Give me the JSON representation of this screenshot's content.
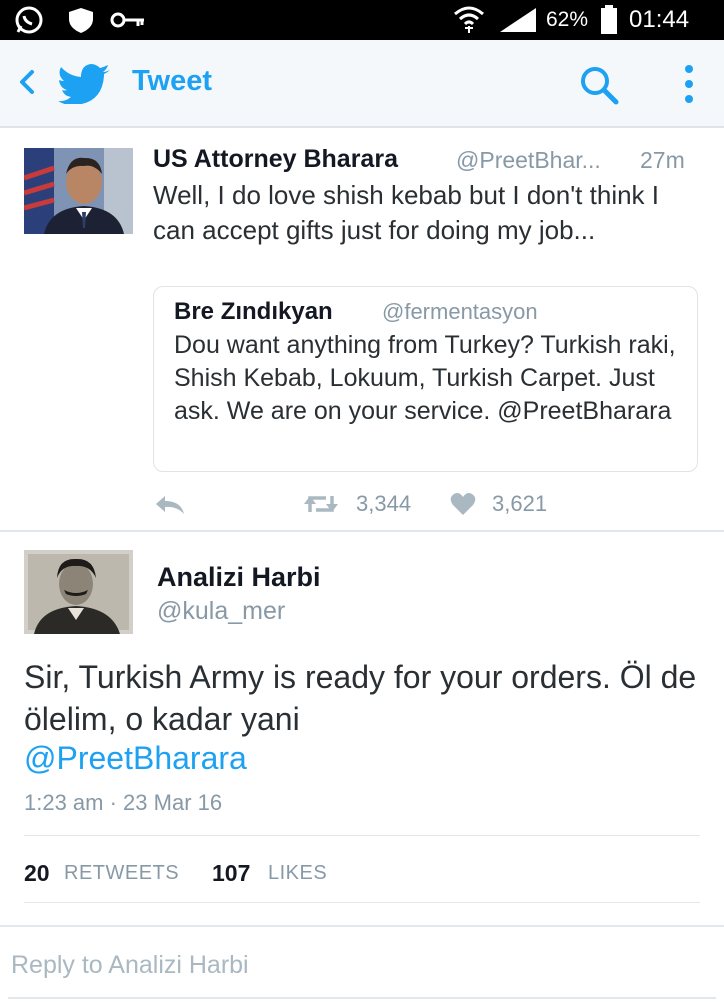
{
  "status_bar": {
    "battery": "62%",
    "time": "01:44",
    "icons": [
      "whatsapp-icon",
      "shield-icon",
      "key-icon",
      "wifi-icon",
      "signal-icon",
      "battery-icon"
    ]
  },
  "app_bar": {
    "title": "Tweet",
    "icons": [
      "back-icon",
      "twitter-bird-icon",
      "search-icon",
      "more-icon"
    ],
    "accent": "#1da1f2"
  },
  "tweet1": {
    "name": "US Attorney Bharara",
    "handle": "@PreetBhar...",
    "time": "27m",
    "text": "Well, I do love shish kebab but I don't think I can accept gifts just for doing my job...",
    "quoted": {
      "name": "Bre Zındıkyan",
      "handle": "@fermentasyon",
      "text": "Dou want anything from Turkey? Turkish raki, Shish Kebab, Lokuum, Turkish Carpet. Just ask. We are on your service. @PreetBharara"
    },
    "retweets": "3,344",
    "likes": "3,621"
  },
  "tweet2": {
    "name": "Analizi Harbi",
    "handle": "@kula_mer",
    "text": "Sir, Turkish Army is ready for your orders. Öl de ölelim, o kadar yani",
    "mention": "@PreetBharara",
    "timestamp": "1:23 am · 23 Mar 16",
    "retweets_count": "20",
    "retweets_label": "RETWEETS",
    "likes_count": "107",
    "likes_label": "LIKES"
  },
  "reply": {
    "placeholder": "Reply to Analizi Harbi"
  }
}
